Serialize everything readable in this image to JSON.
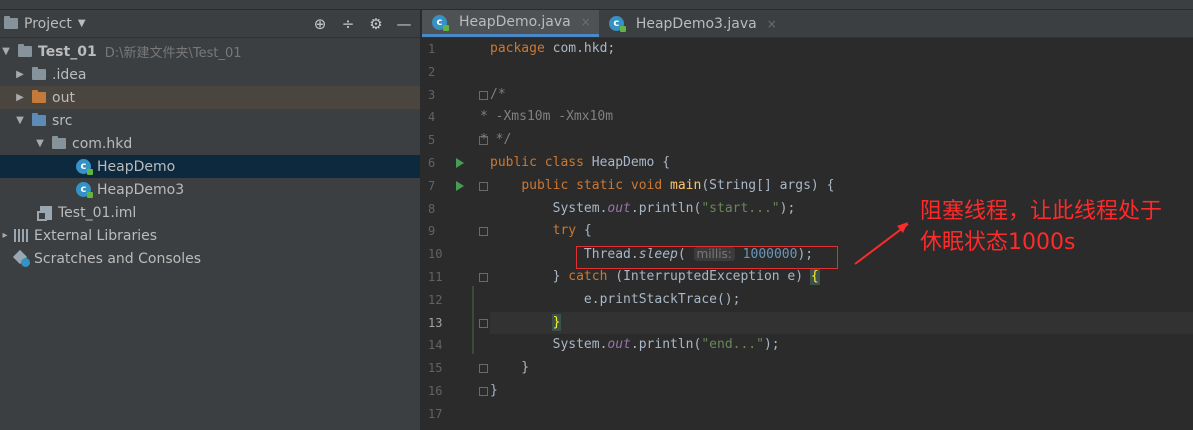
{
  "project_panel": {
    "title": "Project",
    "title_caret": "▼",
    "tools": [
      "⊕",
      "÷",
      "⚙",
      "—"
    ],
    "tree": [
      {
        "label": "Test_01",
        "hint": "D:\\新建文件夹\\Test_01",
        "arrow": "▼",
        "icon": "module-folder-icon",
        "level": 0
      },
      {
        "label": ".idea",
        "arrow": "▶",
        "icon": "folder-icon",
        "level": 1
      },
      {
        "label": "out",
        "arrow": "▶",
        "icon": "folder-orange-icon",
        "level": 1
      },
      {
        "label": "src",
        "arrow": "▼",
        "icon": "folder-blue-icon",
        "level": 1
      },
      {
        "label": "com.hkd",
        "arrow": "▼",
        "icon": "package-icon",
        "level": 2
      },
      {
        "label": "HeapDemo",
        "icon": "java-class-icon",
        "level": 3
      },
      {
        "label": "HeapDemo3",
        "icon": "java-class-icon",
        "level": 3
      },
      {
        "label": "Test_01.iml",
        "icon": "iml-file-icon",
        "level": 1
      },
      {
        "label": "External Libraries",
        "arrow": "▸",
        "icon": "library-icon",
        "level": 0
      },
      {
        "label": "Scratches and Consoles",
        "icon": "scratches-icon",
        "level": 0
      }
    ]
  },
  "tabs": [
    {
      "label": "HeapDemo.java",
      "close": "×"
    },
    {
      "label": "HeapDemo3.java",
      "close": "×"
    }
  ],
  "line_numbers": [
    "1",
    "2",
    "3",
    "4",
    "5",
    "6",
    "7",
    "8",
    "9",
    "10",
    "11",
    "12",
    "13",
    "14",
    "15",
    "16",
    "17"
  ],
  "code": {
    "l1_kw": "package",
    "l1_rest": " com.hkd;",
    "l3": "/*",
    "l4": "* -Xms10m -Xmx10m",
    "l5": "* */",
    "l6_kw": "public class",
    "l6_rest": " HeapDemo {",
    "l7_indent": "    ",
    "l7_kw": "public static void",
    "l7_fn": "main",
    "l7_rest": "(String[] args) {",
    "l8_pre": "        System.",
    "l8_out": "out",
    "l8_mid": ".println(",
    "l8_str": "\"start...\"",
    "l8_end": ");",
    "l9_pre": "        ",
    "l9_kw": "try",
    "l9_rest": " {",
    "l10_pre": "            Thread.",
    "l10_sleep": "sleep",
    "l10_paren": "(",
    "l10_hint": "millis:",
    "l10_num": "1000000",
    "l10_end": ");",
    "l11_pre": "        } ",
    "l11_kw": "catch",
    "l11_rest": " (InterruptedException e) ",
    "l11_brace": "{",
    "l12": "            e.printStackTrace();",
    "l13_pre": "        ",
    "l13_brace": "}",
    "l14_pre": "        System.",
    "l14_out": "out",
    "l14_mid": ".println(",
    "l14_str": "\"end...\"",
    "l14_end": ");",
    "l15": "    }",
    "l16": "}",
    "l17": ""
  },
  "annotation": {
    "text": "阻塞线程，让此线程处于休眠状态1000s",
    "color": "#ff2a2a"
  }
}
